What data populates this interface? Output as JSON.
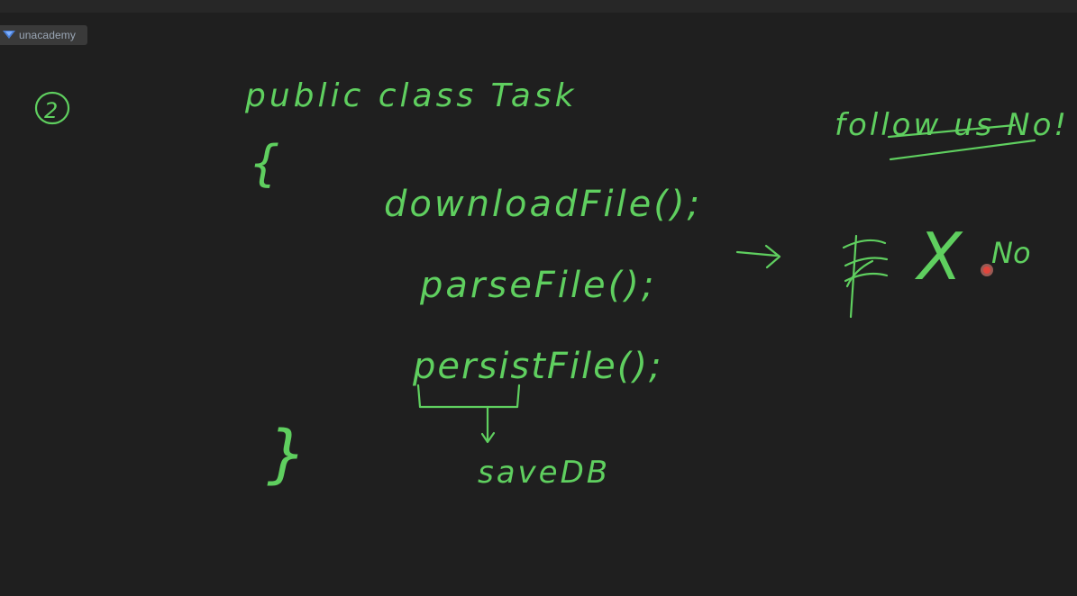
{
  "app": {
    "brand": "unacademy",
    "logo_icon": "unacademy-logo-icon"
  },
  "whiteboard": {
    "background_color": "#1f1f1f",
    "ink_color": "#5fcf5f",
    "section_marker": "2",
    "class_header": "public class Task",
    "open_brace": "{",
    "close_brace": "}",
    "lines": [
      "downloadFile();",
      "parseFile();",
      "persistFile();"
    ],
    "annotation": "saveDB",
    "arrow_icon": "right-arrow-icon",
    "side_note": {
      "heading": "follow us No!",
      "result_mark": "X",
      "result_text": "No"
    },
    "pointer_icon": "laser-pointer-icon"
  }
}
